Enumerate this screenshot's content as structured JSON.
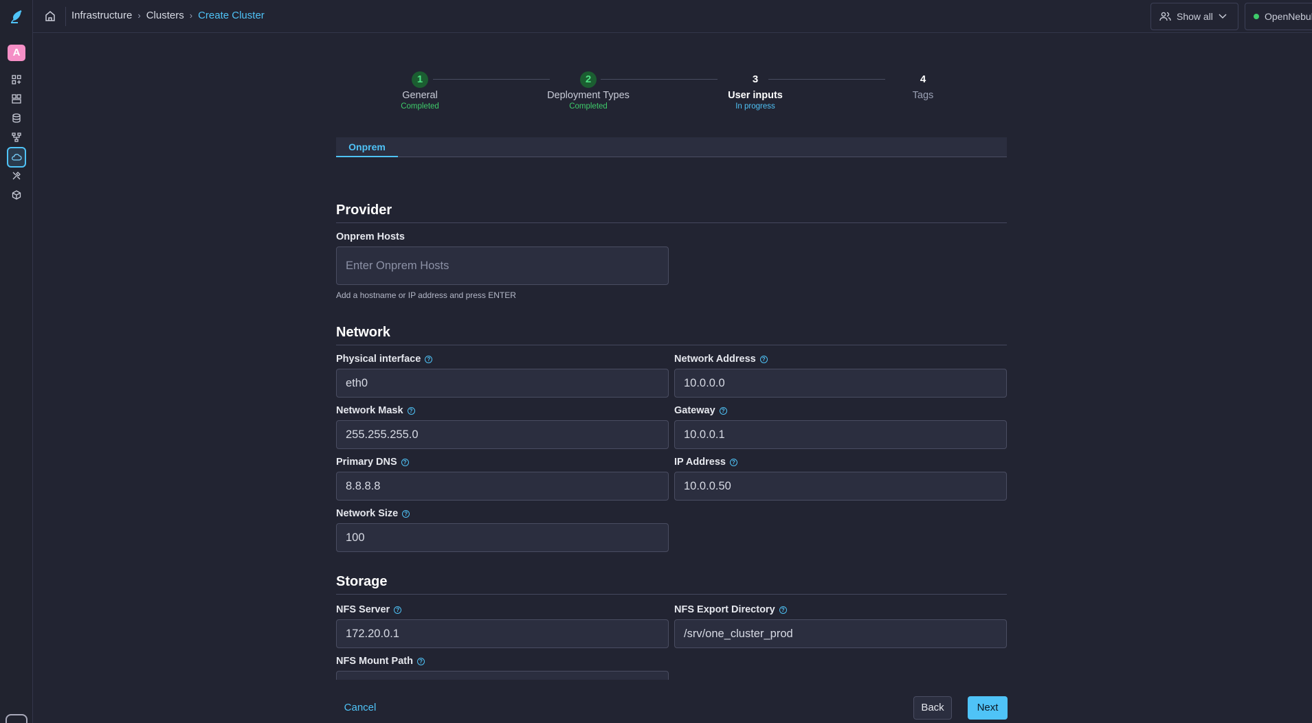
{
  "brand": {
    "logo_icon": "feather-logo-icon",
    "avatar_letter": "A",
    "avatar_color": "#f58fc6",
    "accent": "#4fc3f7"
  },
  "sidebar": {
    "items": [
      {
        "icon": "dashboard-icon"
      },
      {
        "icon": "templates-icon"
      },
      {
        "icon": "storage-icon"
      },
      {
        "icon": "network-icon"
      },
      {
        "icon": "cloud-icon",
        "active": true
      },
      {
        "icon": "tools-icon"
      },
      {
        "icon": "marketplace-icon"
      }
    ]
  },
  "topbar": {
    "breadcrumb": [
      "Infrastructure",
      "Clusters",
      "Create Cluster"
    ],
    "show_all_label": "Show all",
    "zone_label": "OpenNebula",
    "zone_status_color": "#3ecb6a"
  },
  "stepper": {
    "steps": [
      {
        "number": "1",
        "label": "General",
        "status": "Completed"
      },
      {
        "number": "2",
        "label": "Deployment Types",
        "status": "Completed"
      },
      {
        "number": "3",
        "label": "User inputs",
        "status": "In progress"
      },
      {
        "number": "4",
        "label": "Tags",
        "status": ""
      }
    ]
  },
  "tabs": [
    "Onprem"
  ],
  "form": {
    "provider": {
      "title": "Provider",
      "onprem_hosts": {
        "label": "Onprem Hosts",
        "placeholder": "Enter Onprem Hosts",
        "helper": "Add a hostname or IP address and press ENTER"
      }
    },
    "network": {
      "title": "Network",
      "physical_interface": {
        "label": "Physical interface",
        "value": "eth0"
      },
      "network_address": {
        "label": "Network Address",
        "value": "10.0.0.0"
      },
      "network_mask": {
        "label": "Network Mask",
        "value": "255.255.255.0"
      },
      "gateway": {
        "label": "Gateway",
        "value": "10.0.0.1"
      },
      "primary_dns": {
        "label": "Primary DNS",
        "value": "8.8.8.8"
      },
      "ip_address": {
        "label": "IP Address",
        "value": "10.0.0.50"
      },
      "network_size": {
        "label": "Network Size",
        "value": "100"
      }
    },
    "storage": {
      "title": "Storage",
      "nfs_server": {
        "label": "NFS Server",
        "value": "172.20.0.1"
      },
      "nfs_export_directory": {
        "label": "NFS Export Directory",
        "value": "/srv/one_cluster_prod"
      },
      "nfs_mount_path": {
        "label": "NFS Mount Path",
        "value": ""
      }
    }
  },
  "footer": {
    "cancel_label": "Cancel",
    "back_label": "Back",
    "next_label": "Next"
  }
}
